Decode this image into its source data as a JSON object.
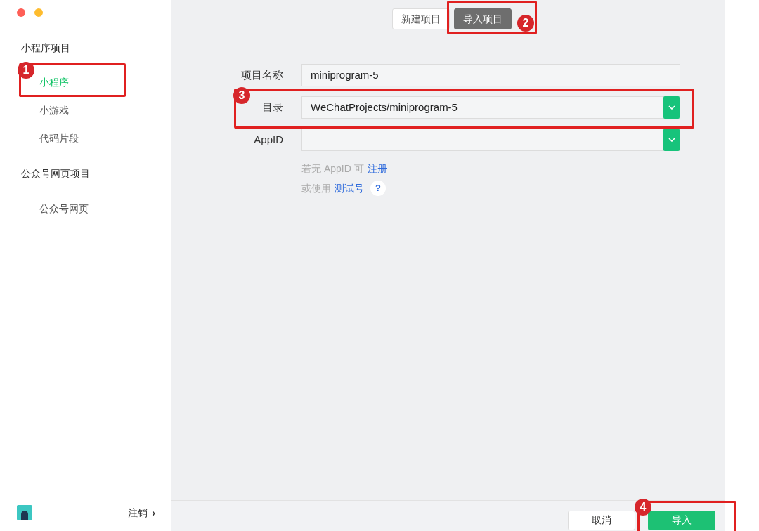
{
  "sidebar": {
    "groups": [
      {
        "title": "小程序项目",
        "items": [
          {
            "label": "小程序",
            "selected": true
          },
          {
            "label": "小游戏",
            "selected": false
          },
          {
            "label": "代码片段",
            "selected": false
          }
        ]
      },
      {
        "title": "公众号网页项目",
        "items": [
          {
            "label": "公众号网页",
            "selected": false
          }
        ]
      }
    ],
    "logout": {
      "label": "注销",
      "chevron": "›"
    }
  },
  "tabs": [
    {
      "label": "新建项目",
      "selected": false
    },
    {
      "label": "导入项目",
      "selected": true
    }
  ],
  "form": {
    "fields": [
      {
        "kind": "text",
        "label": "项目名称",
        "value": "miniprogram-5"
      },
      {
        "kind": "select",
        "label": "目录",
        "value": "WeChatProjects/miniprogram-5"
      },
      {
        "kind": "select",
        "label": "AppID"
      }
    ],
    "hints": [
      {
        "text": "若无 AppID 可",
        "link": "注册"
      },
      {
        "text": "或使用",
        "link": "测试号",
        "help": "?"
      }
    ]
  },
  "buttons": [
    {
      "label": "取消",
      "kind": "secondary"
    },
    {
      "label": "导入",
      "kind": "primary"
    }
  ],
  "annotations": [
    {
      "label": "1"
    },
    {
      "label": "2"
    },
    {
      "label": "3"
    },
    {
      "label": "4"
    }
  ]
}
